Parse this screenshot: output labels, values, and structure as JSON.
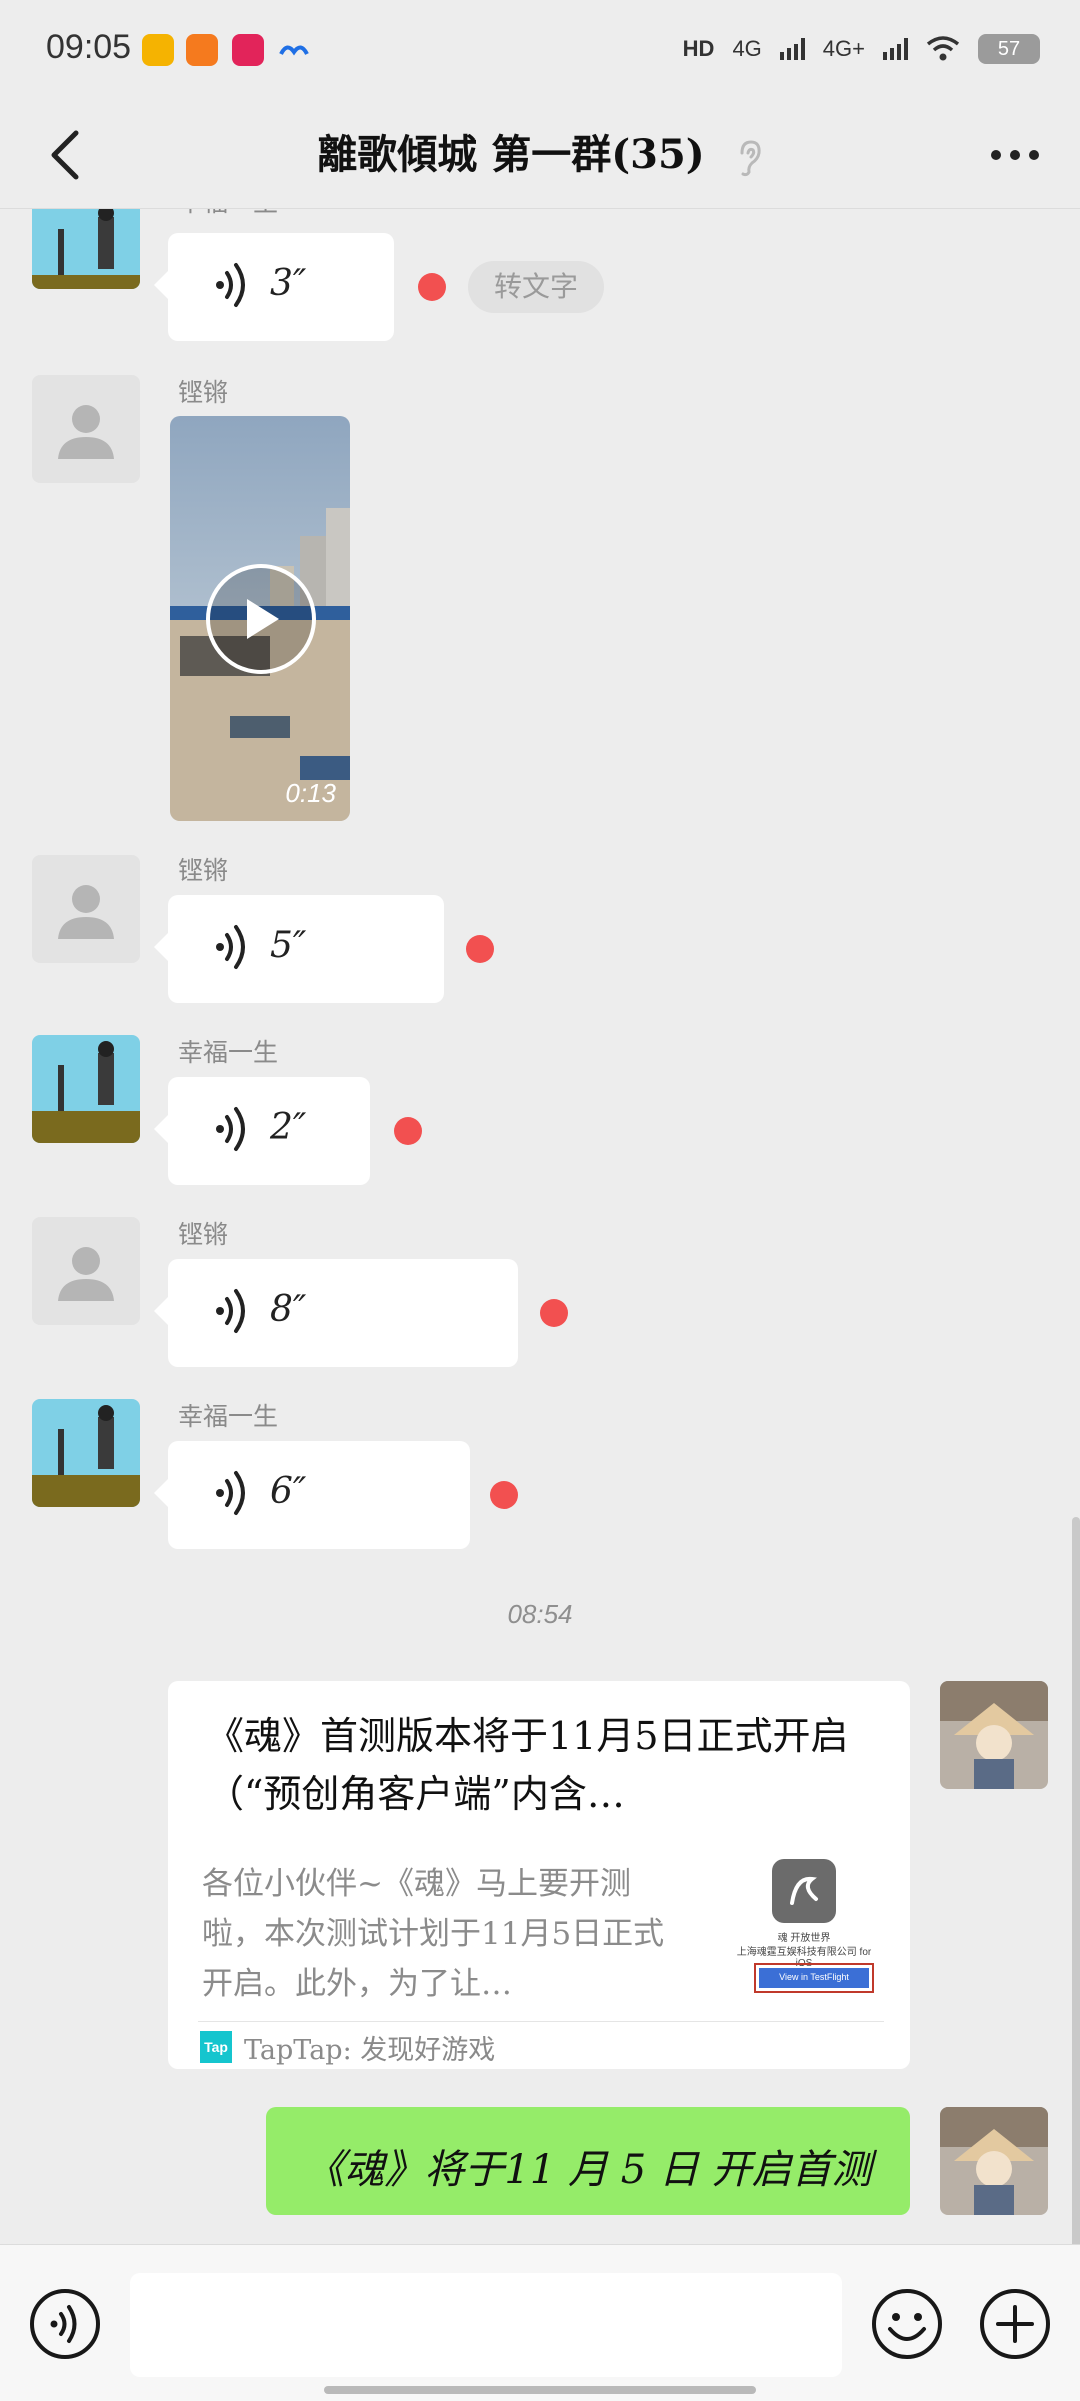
{
  "status_bar": {
    "time": "09:05",
    "network_1": "HD",
    "network_2": "4G",
    "network_3": "4G+",
    "battery": "57",
    "app_icons": [
      "weibo-icon",
      "app-orange-icon",
      "app-red-icon",
      "app-blue-icon"
    ],
    "wifi_icon": "wifi-icon"
  },
  "header": {
    "back_icon": "chevron-left-icon",
    "title": "離歌傾城 第一群(35)",
    "ear_icon": "ear-icon",
    "more_icon": "more-horizontal-icon"
  },
  "messages": {
    "m1": {
      "sender": "幸福一生",
      "duration": "3″",
      "to_text": "转文字"
    },
    "m2": {
      "sender": "铿锵",
      "video_duration": "0:13"
    },
    "m3": {
      "sender": "铿锵",
      "duration": "5″"
    },
    "m4": {
      "sender": "幸福一生",
      "duration": "2″"
    },
    "m5": {
      "sender": "铿锵",
      "duration": "8″"
    },
    "m6": {
      "sender": "幸福一生",
      "duration": "6″"
    },
    "timestamp": "08:54",
    "card": {
      "title": "《魂》首测版本将于11月5日正式开启（“预创角客户端”内含…",
      "description": "各位小伙伴~《魂》马上要开测啦，本次测试计划于11月5日正式开启。此外，为了让…",
      "thumb_title": "魂 开放世界",
      "thumb_company": "上海魂霆互娱科技有限公司 for iOS",
      "thumb_button": "View in TestFlight",
      "source_logo": "Tap",
      "source": "TapTap: 发现好游戏"
    },
    "self_text": "《魂》将于11 月 5 日 开启首测"
  },
  "input_bar": {
    "voice_icon": "voice-mode-icon",
    "text_value": "",
    "emoji_icon": "emoji-icon",
    "plus_icon": "plus-circle-icon"
  },
  "colors": {
    "background": "#ededed",
    "self_bubble": "#95ec69",
    "unread_dot": "#f25050",
    "tap_logo": "#15c5ce"
  }
}
